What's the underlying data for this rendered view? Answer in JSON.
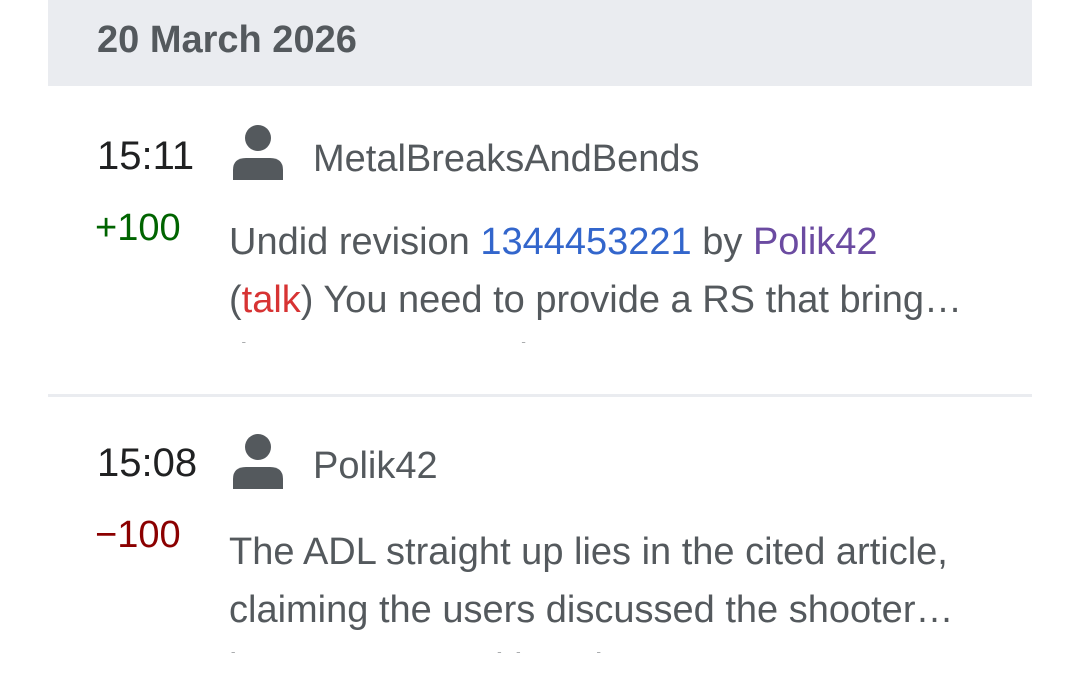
{
  "date_header": "20 March 2026",
  "entries": [
    {
      "time": "15:11",
      "user": "MetalBreaksAndBends",
      "size_diff": "+100",
      "summary": {
        "part1": "Undid revision ",
        "revision_link": "1344453221",
        "part2": " by ",
        "user_link": "Polik42",
        "open_paren": "(",
        "talk_link": "talk",
        "part3": ") You need to provide a RS that bring…",
        "line3": "the ADL's reputation upon ..."
      }
    },
    {
      "time": "15:08",
      "user": "Polik42",
      "size_diff": "−100",
      "summary": {
        "line1": "The ADL straight up lies in the cited article,",
        "line2": "claiming the users discussed the shooter…",
        "line3": "in a manner and location ..."
      }
    }
  ],
  "colors": {
    "added": "#006400",
    "removed": "#8b0000",
    "link": "#3366cc",
    "visited_link": "#6b4ba1",
    "new_link": "#d73333",
    "header_bg": "#eaecf0"
  },
  "icons": {
    "user": "user-avatar-icon"
  }
}
